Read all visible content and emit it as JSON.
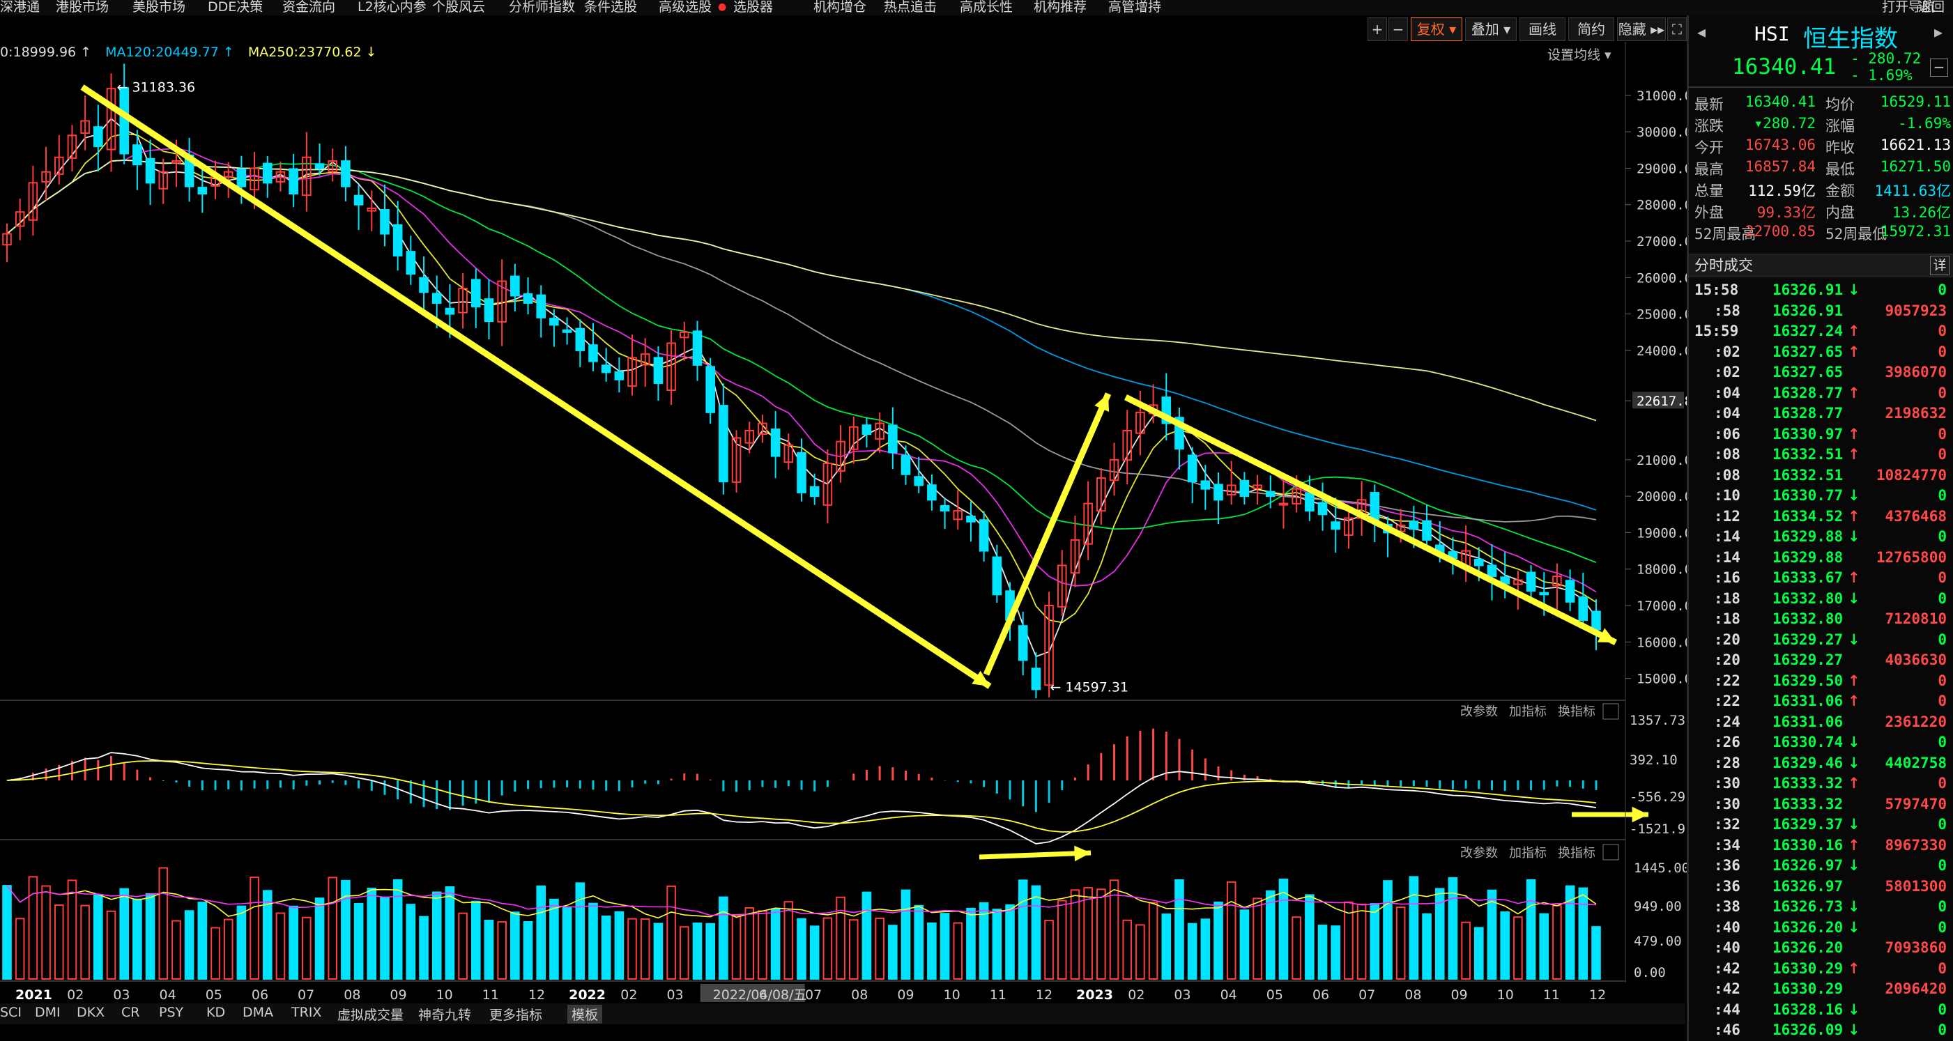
{
  "menu": [
    "深港通",
    "港股市场",
    "美股市场",
    "DDE决策",
    "资金流向",
    "L2核心内参",
    "个股风云",
    "分析师指数",
    "条件选股",
    "高级选股",
    "选股器",
    "机构增仓",
    "热点追击",
    "高成长性",
    "机构推荐",
    "高管增持",
    "打开导航",
    "返回"
  ],
  "toolbar": {
    "plus": "+",
    "minus": "−",
    "restore": "复权",
    "overlay": "叠加",
    "draw": "画线",
    "simple": "简约",
    "hide": "隐藏 ▸▸",
    "fullscreen": "⛶"
  },
  "ma_legend": {
    "ma_first": "0:18999.96 ↑",
    "ma120": "MA120:20449.77 ↑",
    "ma250": "MA250:23770.62 ↓",
    "settings": "设置均线 ▾"
  },
  "colors": {
    "up": "#ff3b3b",
    "down": "#00e5ff",
    "yellow": "#ffff33",
    "green_text": "#00ff44",
    "price_red": "#ff4a4a"
  },
  "chart_data": {
    "type": "candlestick",
    "price_axis": {
      "ticks": [
        31000,
        30000,
        29000,
        28000,
        27000,
        26000,
        25000,
        24000,
        22617.8,
        21000,
        20000,
        19000,
        18000,
        17000,
        16000,
        15000
      ],
      "ylim": [
        14400,
        31800
      ],
      "current_price_label": "22617.8"
    },
    "x_labels": [
      "2021",
      "02",
      "03",
      "04",
      "05",
      "06",
      "07",
      "08",
      "09",
      "10",
      "11",
      "12",
      "2022",
      "02",
      "03",
      "2022/04/08/五",
      "6",
      "07",
      "08",
      "09",
      "10",
      "11",
      "12",
      "2023",
      "02",
      "03",
      "04",
      "05",
      "06",
      "07",
      "08",
      "09",
      "10",
      "11",
      "12"
    ],
    "annotations": {
      "high": "31183.36",
      "low": "14597.31"
    },
    "closes": [
      27200,
      27800,
      28600,
      28900,
      29300,
      29900,
      30300,
      29600,
      31183,
      29400,
      29100,
      28600,
      28900,
      29200,
      28500,
      28300,
      28800,
      28900,
      28500,
      29000,
      28600,
      28900,
      28300,
      29300,
      29000,
      29200,
      28500,
      28000,
      27900,
      27200,
      26600,
      26100,
      25600,
      25300,
      25000,
      25700,
      25200,
      24800,
      25900,
      25500,
      25300,
      24900,
      24700,
      24500,
      24000,
      23700,
      23400,
      23200,
      23800,
      23900,
      23100,
      24200,
      24500,
      23600,
      22300,
      20400,
      21600,
      21800,
      22000,
      21100,
      21400,
      20100,
      20000,
      20900,
      21500,
      21900,
      21700,
      22000,
      21200,
      20600,
      20300,
      19900,
      19600,
      19600,
      19300,
      18500,
      17300,
      16600,
      15500,
      14700,
      17000,
      18100,
      18800,
      19800,
      20500,
      21000,
      21800,
      22300,
      22500,
      22000,
      21300,
      20400,
      20200,
      19900,
      20300,
      20000,
      20300,
      20000,
      19800,
      20200,
      19600,
      19500,
      19100,
      19400,
      19900,
      19300,
      19000,
      19200,
      19100,
      18800,
      18400,
      18300,
      18500,
      18100,
      17800,
      17600,
      17700,
      17400,
      17300,
      17800,
      17100,
      16600,
      16340
    ],
    "macd_axis": [
      "1357.73",
      "392.10",
      "-556.29",
      "-1521.91"
    ],
    "volume_axis": [
      "1445.00",
      "949.00",
      "479.00",
      "0.00"
    ],
    "panel_buttons": [
      "改参数",
      "加指标",
      "换指标"
    ]
  },
  "sidebar": {
    "symbol": "HSI",
    "name": "恒生指数",
    "price": "16340.41",
    "change": "- 280.72",
    "change_pct": "- 1.69%",
    "stats": [
      {
        "l1": "最新",
        "v1": "16340.41",
        "c1": "#00ff44",
        "l2": "均价",
        "v2": "16529.11",
        "c2": "#00ff44"
      },
      {
        "l1": "涨跌",
        "v1": "▾280.72",
        "c1": "#00ff44",
        "l2": "涨幅",
        "v2": "-1.69%",
        "c2": "#00ff44"
      },
      {
        "l1": "今开",
        "v1": "16743.06",
        "c1": "#ff4a4a",
        "l2": "昨收",
        "v2": "16621.13",
        "c2": "#ffffff"
      },
      {
        "l1": "最高",
        "v1": "16857.84",
        "c1": "#ff4a4a",
        "l2": "最低",
        "v2": "16271.50",
        "c2": "#00ff44"
      },
      {
        "l1": "总量",
        "v1": "112.59亿",
        "c1": "#ffffff",
        "l2": "金额",
        "v2": "1411.63亿",
        "c2": "#00e5ff"
      },
      {
        "l1": "外盘",
        "v1": "99.33亿",
        "c1": "#ff4a4a",
        "l2": "内盘",
        "v2": "13.26亿",
        "c2": "#00ff44"
      },
      {
        "l1": "52周最高",
        "v1": "22700.85",
        "c1": "#ff4a4a",
        "l2": "52周最低",
        "v2": "15972.31",
        "c2": "#00ff44"
      }
    ],
    "ticks_title": "分时成交",
    "ticks_detail": "详",
    "ticks": [
      {
        "t": "15:58",
        "p": "16326.91",
        "a": "↓",
        "ac": "#00ff44",
        "v": "0",
        "vc": "#00ff44"
      },
      {
        "t": ":58",
        "p": "16326.91",
        "a": "",
        "ac": "",
        "v": "9057923",
        "vc": "#ff4a4a"
      },
      {
        "t": "15:59",
        "p": "16327.24",
        "a": "↑",
        "ac": "#ff4a4a",
        "v": "0",
        "vc": "#ff4a4a"
      },
      {
        "t": ":02",
        "p": "16327.65",
        "a": "↑",
        "ac": "#ff4a4a",
        "v": "0",
        "vc": "#ff4a4a"
      },
      {
        "t": ":02",
        "p": "16327.65",
        "a": "",
        "ac": "",
        "v": "3986070",
        "vc": "#ff4a4a"
      },
      {
        "t": ":04",
        "p": "16328.77",
        "a": "↑",
        "ac": "#ff4a4a",
        "v": "0",
        "vc": "#ff4a4a"
      },
      {
        "t": ":04",
        "p": "16328.77",
        "a": "",
        "ac": "",
        "v": "2198632",
        "vc": "#ff4a4a"
      },
      {
        "t": ":06",
        "p": "16330.97",
        "a": "↑",
        "ac": "#ff4a4a",
        "v": "0",
        "vc": "#ff4a4a"
      },
      {
        "t": ":08",
        "p": "16332.51",
        "a": "↑",
        "ac": "#ff4a4a",
        "v": "0",
        "vc": "#ff4a4a"
      },
      {
        "t": ":08",
        "p": "16332.51",
        "a": "",
        "ac": "",
        "v": "10824770",
        "vc": "#ff4a4a"
      },
      {
        "t": ":10",
        "p": "16330.77",
        "a": "↓",
        "ac": "#00ff44",
        "v": "0",
        "vc": "#00ff44"
      },
      {
        "t": ":12",
        "p": "16334.52",
        "a": "↑",
        "ac": "#ff4a4a",
        "v": "4376468",
        "vc": "#ff4a4a"
      },
      {
        "t": ":14",
        "p": "16329.88",
        "a": "↓",
        "ac": "#00ff44",
        "v": "0",
        "vc": "#00ff44"
      },
      {
        "t": ":14",
        "p": "16329.88",
        "a": "",
        "ac": "",
        "v": "12765800",
        "vc": "#ff4a4a"
      },
      {
        "t": ":16",
        "p": "16333.67",
        "a": "↑",
        "ac": "#ff4a4a",
        "v": "0",
        "vc": "#ff4a4a"
      },
      {
        "t": ":18",
        "p": "16332.80",
        "a": "↓",
        "ac": "#00ff44",
        "v": "0",
        "vc": "#00ff44"
      },
      {
        "t": ":18",
        "p": "16332.80",
        "a": "",
        "ac": "",
        "v": "7120810",
        "vc": "#ff4a4a"
      },
      {
        "t": ":20",
        "p": "16329.27",
        "a": "↓",
        "ac": "#00ff44",
        "v": "0",
        "vc": "#00ff44"
      },
      {
        "t": ":20",
        "p": "16329.27",
        "a": "",
        "ac": "",
        "v": "4036630",
        "vc": "#ff4a4a"
      },
      {
        "t": ":22",
        "p": "16329.50",
        "a": "↑",
        "ac": "#ff4a4a",
        "v": "0",
        "vc": "#ff4a4a"
      },
      {
        "t": ":22",
        "p": "16331.06",
        "a": "↑",
        "ac": "#ff4a4a",
        "v": "0",
        "vc": "#ff4a4a"
      },
      {
        "t": ":24",
        "p": "16331.06",
        "a": "",
        "ac": "",
        "v": "2361220",
        "vc": "#ff4a4a"
      },
      {
        "t": ":26",
        "p": "16330.74",
        "a": "↓",
        "ac": "#00ff44",
        "v": "0",
        "vc": "#00ff44"
      },
      {
        "t": ":28",
        "p": "16329.46",
        "a": "↓",
        "ac": "#00ff44",
        "v": "4402758",
        "vc": "#00ff44"
      },
      {
        "t": ":30",
        "p": "16333.32",
        "a": "↑",
        "ac": "#ff4a4a",
        "v": "0",
        "vc": "#ff4a4a"
      },
      {
        "t": ":30",
        "p": "16333.32",
        "a": "",
        "ac": "",
        "v": "5797470",
        "vc": "#ff4a4a"
      },
      {
        "t": ":32",
        "p": "16329.37",
        "a": "↓",
        "ac": "#00ff44",
        "v": "0",
        "vc": "#00ff44"
      },
      {
        "t": ":34",
        "p": "16330.16",
        "a": "↑",
        "ac": "#ff4a4a",
        "v": "8967330",
        "vc": "#ff4a4a"
      },
      {
        "t": ":36",
        "p": "16326.97",
        "a": "↓",
        "ac": "#00ff44",
        "v": "0",
        "vc": "#00ff44"
      },
      {
        "t": ":36",
        "p": "16326.97",
        "a": "",
        "ac": "",
        "v": "5801300",
        "vc": "#ff4a4a"
      },
      {
        "t": ":38",
        "p": "16326.73",
        "a": "↓",
        "ac": "#00ff44",
        "v": "0",
        "vc": "#00ff44"
      },
      {
        "t": ":40",
        "p": "16326.20",
        "a": "↓",
        "ac": "#00ff44",
        "v": "0",
        "vc": "#00ff44"
      },
      {
        "t": ":40",
        "p": "16326.20",
        "a": "",
        "ac": "",
        "v": "7093860",
        "vc": "#ff4a4a"
      },
      {
        "t": ":42",
        "p": "16330.29",
        "a": "↑",
        "ac": "#ff4a4a",
        "v": "0",
        "vc": "#ff4a4a"
      },
      {
        "t": ":42",
        "p": "16330.29",
        "a": "",
        "ac": "",
        "v": "2096420",
        "vc": "#ff4a4a"
      },
      {
        "t": ":44",
        "p": "16328.16",
        "a": "↓",
        "ac": "#00ff44",
        "v": "0",
        "vc": "#00ff44"
      },
      {
        "t": ":46",
        "p": "16326.09",
        "a": "↓",
        "ac": "#00ff44",
        "v": "0",
        "vc": "#00ff44"
      }
    ]
  },
  "bottom_tabs": [
    "SCI",
    "DMI",
    "DKX",
    "CR",
    "PSY",
    "KD",
    "DMA",
    "TRIX",
    "虚拟成交量",
    "神奇九转",
    "更多指标",
    "模板"
  ]
}
